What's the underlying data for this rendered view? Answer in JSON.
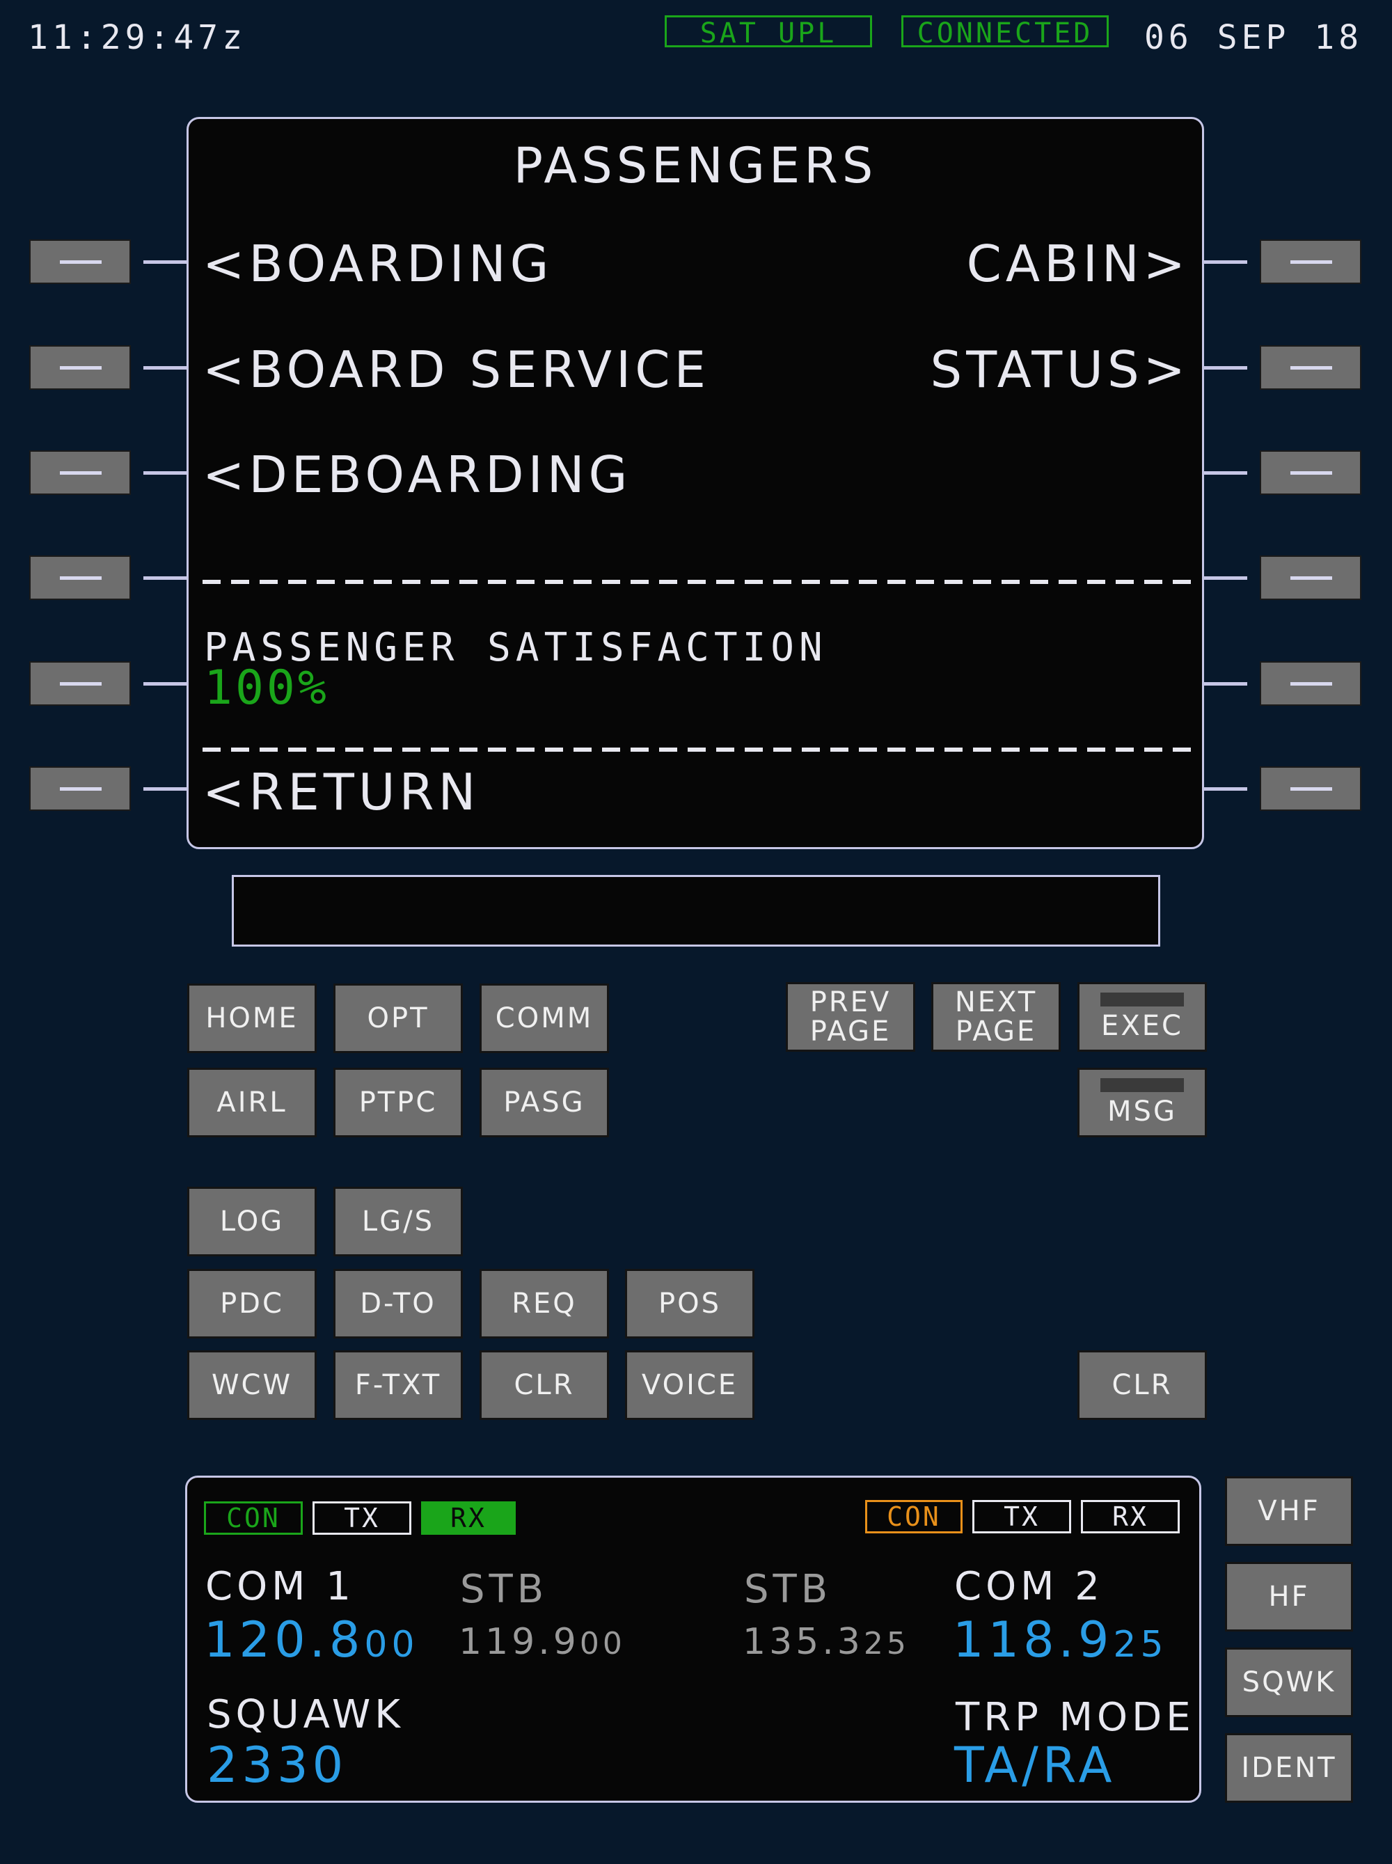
{
  "header": {
    "time": "11:29:47z",
    "date": "06 SEP 18",
    "status_sat": "SAT UPL",
    "status_conn": "CONNECTED",
    "status_color": "#1aa51a"
  },
  "screen": {
    "title": "PASSENGERS",
    "left_lines": [
      "<BOARDING",
      "<BOARD SERVICE",
      "<DEBOARDING",
      "<RETURN"
    ],
    "right_lines": [
      "CABIN>",
      "STATUS>"
    ],
    "satisfaction_label": "PASSENGER SATISFACTION",
    "satisfaction_value": "100%"
  },
  "scratchpad": {
    "text": ""
  },
  "keys": {
    "home": "HOME",
    "opt": "OPT",
    "comm": "COMM",
    "prev_1": "PREV",
    "prev_2": "PAGE",
    "next_1": "NEXT",
    "next_2": "PAGE",
    "exec": "EXEC",
    "airl": "AIRL",
    "ptpc": "PTPC",
    "pasg": "PASG",
    "msg": "MSG",
    "log": "LOG",
    "lgs": "LG/S",
    "pdc": "PDC",
    "dto": "D-TO",
    "req": "REQ",
    "pos": "POS",
    "wcw": "WCW",
    "ftxt": "F-TXT",
    "clr": "CLR",
    "voice": "VOICE",
    "clr2": "CLR"
  },
  "radio": {
    "com1": {
      "con": "CON",
      "tx": "TX",
      "rx": "RX",
      "label": "COM 1",
      "active_main": "120.8",
      "active_tail": "00",
      "stb_label": "STB",
      "stb_freq_main": "119.9",
      "stb_freq_tail": "00"
    },
    "com2": {
      "con": "CON",
      "tx": "TX",
      "rx": "RX",
      "label": "COM 2",
      "active_main": "118.9",
      "active_tail": "25",
      "stb_label": "STB",
      "stb_freq_main": "135.3",
      "stb_freq_tail": "25"
    },
    "squawk_label": "SQUAWK",
    "squawk_value": "2330",
    "trp_label": "TRP MODE",
    "trp_value": "TA/RA",
    "colors": {
      "active": "#2a9de6",
      "con_green": "#1aa51a",
      "con_orange": "#e8901a",
      "standby": "#9a9a9a"
    }
  },
  "side_keys": {
    "vhf": "VHF",
    "hf": "HF",
    "sqwk": "SQWK",
    "ident": "IDENT"
  }
}
